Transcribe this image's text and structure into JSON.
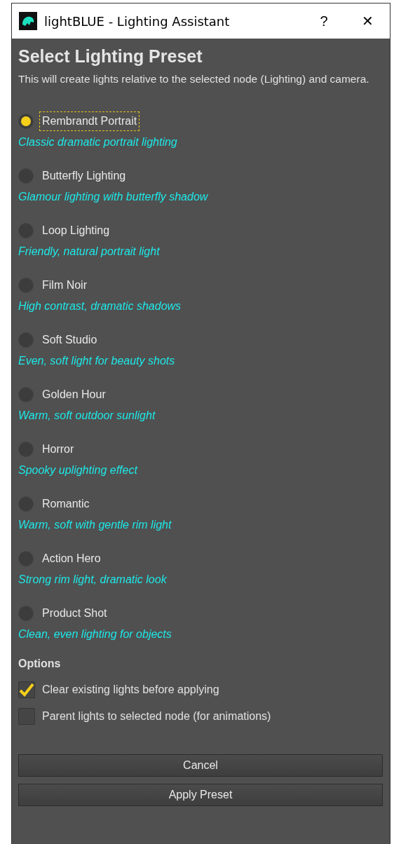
{
  "window": {
    "title": "lightBLUE - Lighting Assistant",
    "help": "?",
    "close": "✕"
  },
  "heading": "Select Lighting Preset",
  "intro": "This will create lights relative to the selected node (Lighting) and camera.",
  "presets": [
    {
      "label": "Rembrandt Portrait",
      "description": "Classic dramatic portrait lighting",
      "selected": true
    },
    {
      "label": "Butterfly Lighting",
      "description": "Glamour lighting with butterfly shadow",
      "selected": false
    },
    {
      "label": "Loop Lighting",
      "description": "Friendly, natural portrait light",
      "selected": false
    },
    {
      "label": "Film Noir",
      "description": "High contrast, dramatic shadows",
      "selected": false
    },
    {
      "label": "Soft Studio",
      "description": "Even, soft light for beauty shots",
      "selected": false
    },
    {
      "label": "Golden Hour",
      "description": "Warm, soft outdoor sunlight",
      "selected": false
    },
    {
      "label": "Horror",
      "description": "Spooky uplighting effect",
      "selected": false
    },
    {
      "label": "Romantic",
      "description": "Warm, soft with gentle rim light",
      "selected": false
    },
    {
      "label": "Action Hero",
      "description": "Strong rim light, dramatic look",
      "selected": false
    },
    {
      "label": "Product Shot",
      "description": "Clean, even lighting for objects",
      "selected": false
    }
  ],
  "options": {
    "heading": "Options",
    "items": [
      {
        "label": "Clear existing lights before applying",
        "checked": true
      },
      {
        "label": "Parent lights to selected node (for animations)",
        "checked": false
      }
    ]
  },
  "buttons": [
    "Cancel",
    "Apply Preset"
  ]
}
